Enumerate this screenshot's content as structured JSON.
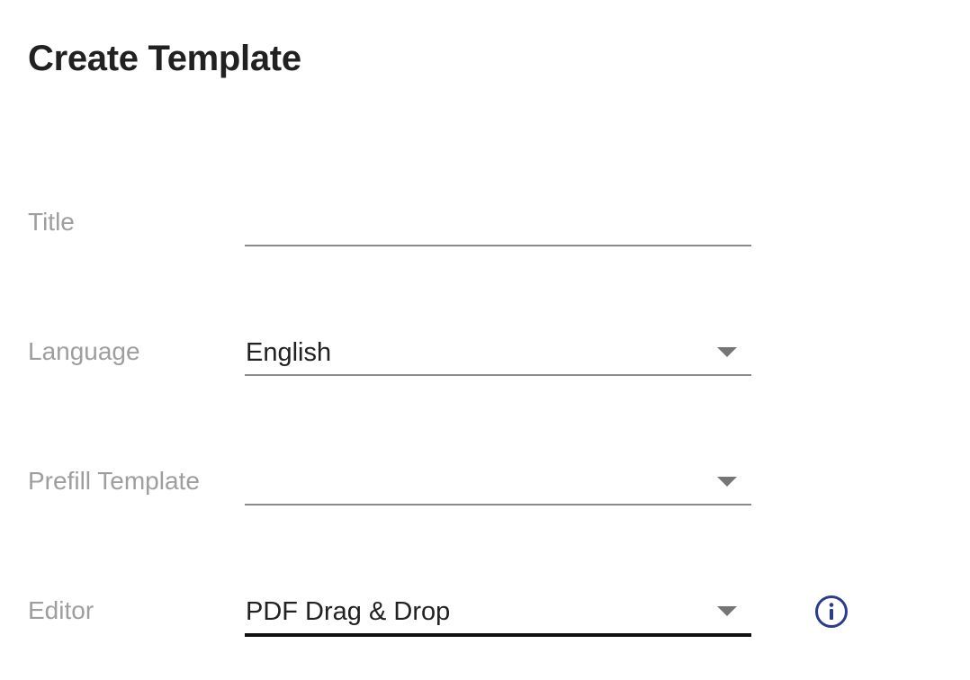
{
  "page": {
    "title": "Create Template"
  },
  "form": {
    "title_field": {
      "label": "Title",
      "value": "",
      "placeholder": ""
    },
    "language_field": {
      "label": "Language",
      "selected": "English"
    },
    "prefill_field": {
      "label": "Prefill Template",
      "selected": ""
    },
    "editor_field": {
      "label": "Editor",
      "selected": "PDF Drag & Drop"
    }
  },
  "icons": {
    "dropdown": "triangle-down-icon",
    "info": "info-circle-icon"
  },
  "colors": {
    "label": "#9e9e9e",
    "text": "#212121",
    "underline": "#8a8a8a",
    "underline_focused": "#111111",
    "arrow": "#757575",
    "info_icon": "#2b3b8f"
  }
}
